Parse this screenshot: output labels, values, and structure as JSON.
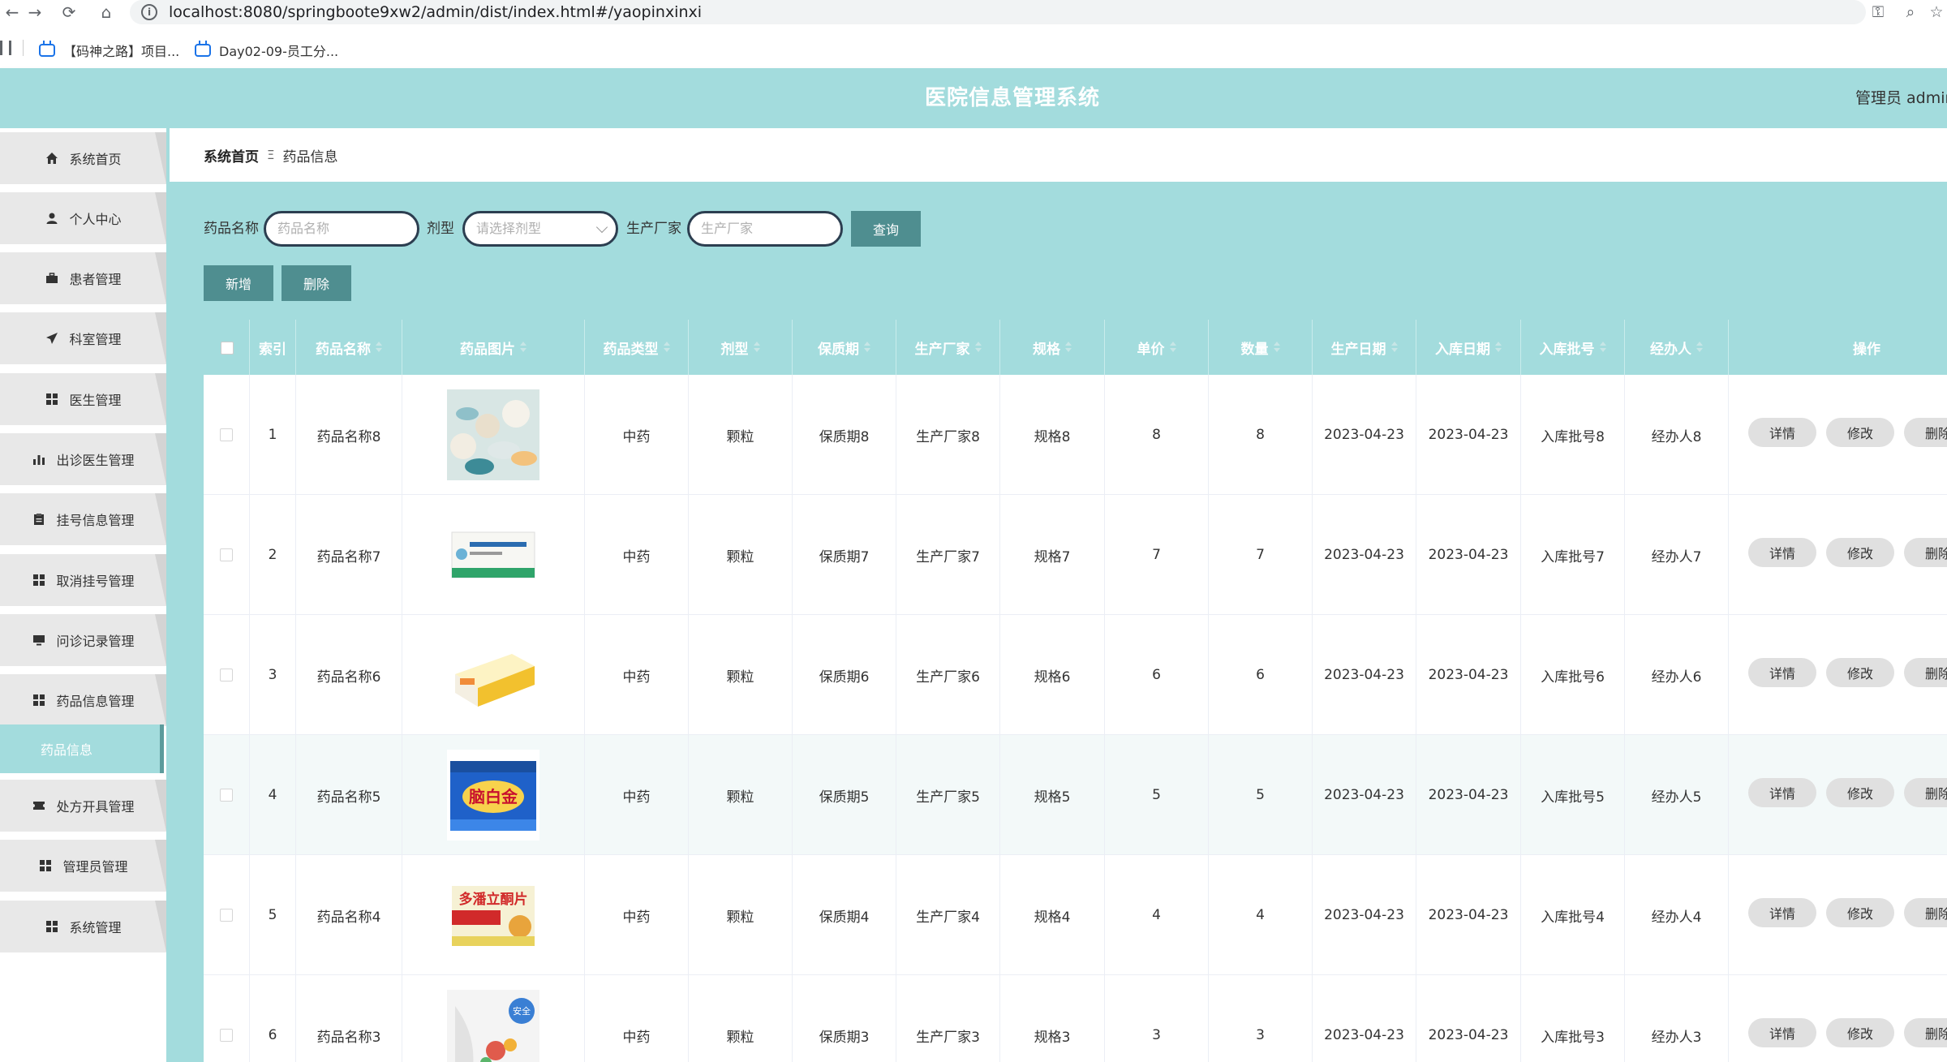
{
  "browser": {
    "url": "localhost:8080/springboote9xw2/admin/dist/index.html#/yaopinxinxi",
    "bookmarks": [
      {
        "label": "【码神之路】项目..."
      },
      {
        "label": "Day02-09-员工分..."
      }
    ]
  },
  "header": {
    "title": "医院信息管理系统",
    "user": "管理员 admin"
  },
  "sidebar": {
    "items": [
      {
        "label": "系统首页",
        "icon": "home-icon"
      },
      {
        "label": "个人中心",
        "icon": "user-icon"
      },
      {
        "label": "患者管理",
        "icon": "briefcase-icon"
      },
      {
        "label": "科室管理",
        "icon": "send-icon"
      },
      {
        "label": "医生管理",
        "icon": "grid-icon"
      },
      {
        "label": "出诊医生管理",
        "icon": "bar-chart-icon"
      },
      {
        "label": "挂号信息管理",
        "icon": "clipboard-icon"
      },
      {
        "label": "取消挂号管理",
        "icon": "grid-icon"
      },
      {
        "label": "问诊记录管理",
        "icon": "monitor-icon"
      },
      {
        "label": "药品信息管理",
        "icon": "grid-icon"
      }
    ],
    "active_sub": "药品信息",
    "items_after": [
      {
        "label": "处方开具管理",
        "icon": "ticket-icon"
      },
      {
        "label": "管理员管理",
        "icon": "grid-icon"
      },
      {
        "label": "系统管理",
        "icon": "grid-icon"
      }
    ]
  },
  "breadcrumb": {
    "home": "系统首页",
    "separator": "Ξ",
    "current": "药品信息"
  },
  "filters": {
    "name_label": "药品名称",
    "name_placeholder": "药品名称",
    "form_label": "剂型",
    "form_placeholder": "请选择剂型",
    "maker_label": "生产厂家",
    "maker_placeholder": "生产厂家",
    "search_button": "查询"
  },
  "actions": {
    "add": "新增",
    "delete": "删除"
  },
  "table": {
    "columns": [
      "索引",
      "药品名称",
      "药品图片",
      "药品类型",
      "剂型",
      "保质期",
      "生产厂家",
      "规格",
      "单价",
      "数量",
      "生产日期",
      "入库日期",
      "入库批号",
      "经办人",
      "操作"
    ],
    "rows": [
      {
        "index": "1",
        "name": "药品名称8",
        "type": "中药",
        "form": "颗粒",
        "shelf": "保质期8",
        "maker": "生产厂家8",
        "spec": "规格8",
        "price": "8",
        "qty": "8",
        "pdate": "2023-04-23",
        "sdate": "2023-04-23",
        "batch": "入库批号8",
        "agent": "经办人8"
      },
      {
        "index": "2",
        "name": "药品名称7",
        "type": "中药",
        "form": "颗粒",
        "shelf": "保质期7",
        "maker": "生产厂家7",
        "spec": "规格7",
        "price": "7",
        "qty": "7",
        "pdate": "2023-04-23",
        "sdate": "2023-04-23",
        "batch": "入库批号7",
        "agent": "经办人7"
      },
      {
        "index": "3",
        "name": "药品名称6",
        "type": "中药",
        "form": "颗粒",
        "shelf": "保质期6",
        "maker": "生产厂家6",
        "spec": "规格6",
        "price": "6",
        "qty": "6",
        "pdate": "2023-04-23",
        "sdate": "2023-04-23",
        "batch": "入库批号6",
        "agent": "经办人6"
      },
      {
        "index": "4",
        "name": "药品名称5",
        "type": "中药",
        "form": "颗粒",
        "shelf": "保质期5",
        "maker": "生产厂家5",
        "spec": "规格5",
        "price": "5",
        "qty": "5",
        "pdate": "2023-04-23",
        "sdate": "2023-04-23",
        "batch": "入库批号5",
        "agent": "经办人5"
      },
      {
        "index": "5",
        "name": "药品名称4",
        "type": "中药",
        "form": "颗粒",
        "shelf": "保质期4",
        "maker": "生产厂家4",
        "spec": "规格4",
        "price": "4",
        "qty": "4",
        "pdate": "2023-04-23",
        "sdate": "2023-04-23",
        "batch": "入库批号4",
        "agent": "经办人4"
      },
      {
        "index": "6",
        "name": "药品名称3",
        "type": "中药",
        "form": "颗粒",
        "shelf": "保质期3",
        "maker": "生产厂家3",
        "spec": "规格3",
        "price": "3",
        "qty": "3",
        "pdate": "2023-04-23",
        "sdate": "2023-04-23",
        "batch": "入库批号3",
        "agent": "经办人3"
      }
    ],
    "op_labels": {
      "detail": "详情",
      "edit": "修改",
      "delete": "删除"
    }
  },
  "colors": {
    "accent": "#a3dcdd",
    "button": "#4f8e90",
    "sidebar_item": "#e8e8e8"
  }
}
